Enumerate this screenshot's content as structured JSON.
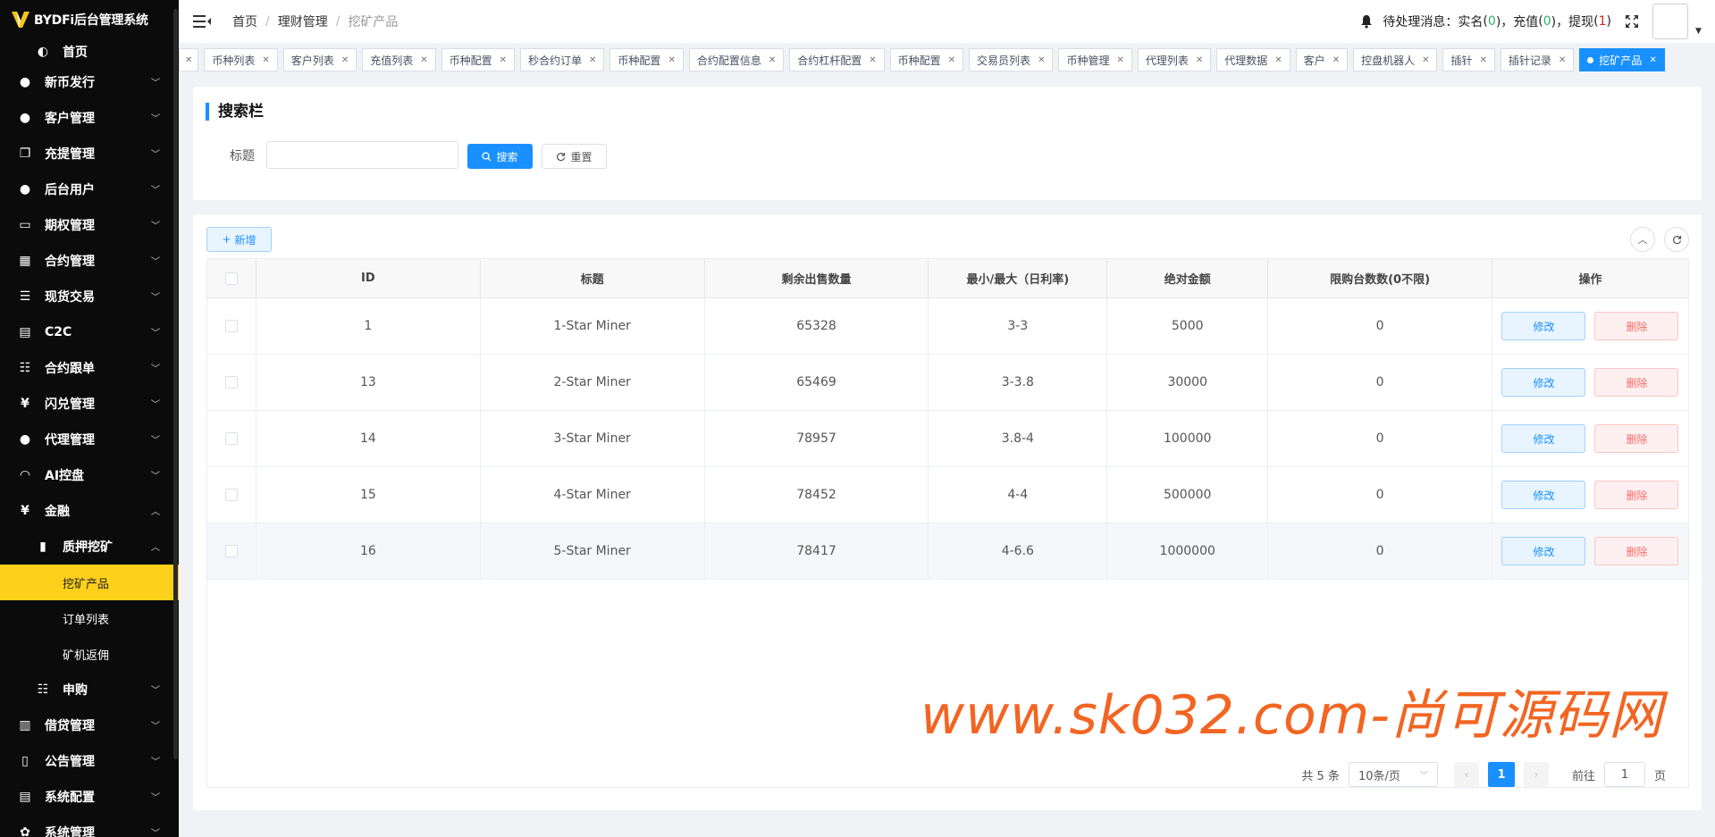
{
  "logo": {
    "brand": "BYDFi",
    "system": "后台管理系统"
  },
  "sidebar": {
    "items": [
      {
        "label": "首页",
        "icon": "dashboard-icon"
      },
      {
        "label": "新币发行",
        "icon": "user-icon"
      },
      {
        "label": "客户管理",
        "icon": "user-icon"
      },
      {
        "label": "充提管理",
        "icon": "copy-icon"
      },
      {
        "label": "后台用户",
        "icon": "users-icon"
      },
      {
        "label": "期权管理",
        "icon": "monitor-icon"
      },
      {
        "label": "合约管理",
        "icon": "grid-icon"
      },
      {
        "label": "现货交易",
        "icon": "list-icon"
      },
      {
        "label": "C2C",
        "icon": "document-icon"
      },
      {
        "label": "合约跟单",
        "icon": "tree-list-icon"
      },
      {
        "label": "闪兑管理",
        "icon": "yen-icon"
      },
      {
        "label": "代理管理",
        "icon": "user-icon"
      },
      {
        "label": "AI控盘",
        "icon": "headset-icon"
      },
      {
        "label": "金融",
        "icon": "yen-icon"
      },
      {
        "label": "质押挖矿",
        "icon": "bar-chart-icon"
      },
      {
        "label": "挖矿产品",
        "icon": ""
      },
      {
        "label": "订单列表",
        "icon": ""
      },
      {
        "label": "矿机返佣",
        "icon": ""
      },
      {
        "label": "申购",
        "icon": "tree-list-icon"
      },
      {
        "label": "借贷管理",
        "icon": "book-icon"
      },
      {
        "label": "公告管理",
        "icon": "book-open-icon"
      },
      {
        "label": "系统配置",
        "icon": "document-icon"
      },
      {
        "label": "系统管理",
        "icon": "gear-icon"
      }
    ]
  },
  "header": {
    "breadcrumb": [
      "首页",
      "理财管理",
      "挖矿产品"
    ],
    "notice_label": "待处理消息：",
    "realname_label": "实名",
    "realname_count": "0",
    "recharge_label": "充值",
    "recharge_count": "0",
    "withdraw_label": "提现",
    "withdraw_count": "1"
  },
  "tags": [
    "币种列表",
    "客户列表",
    "充值列表",
    "币种配置",
    "秒合约订单",
    "币种配置",
    "合约配置信息",
    "合约杠杆配置",
    "币种配置",
    "交易员列表",
    "币种管理",
    "代理列表",
    "代理数据",
    "客户",
    "控盘机器人",
    "插针",
    "插针记录",
    "挖矿产品"
  ],
  "search": {
    "title": "搜索栏",
    "field_label": "标题",
    "placeholder": "",
    "search_btn": "搜索",
    "reset_btn": "重置"
  },
  "table": {
    "add_btn": "新增",
    "columns": [
      "ID",
      "标题",
      "剩余出售数量",
      "最小/最大（日利率)",
      "绝对金额",
      "限购台数数(0不限)",
      "操作"
    ],
    "rows": [
      {
        "id": "1",
        "title": "1-Star Miner",
        "remaining": "65328",
        "rate": "3-3",
        "amount": "5000",
        "limit": "0"
      },
      {
        "id": "13",
        "title": "2-Star Miner",
        "remaining": "65469",
        "rate": "3-3.8",
        "amount": "30000",
        "limit": "0"
      },
      {
        "id": "14",
        "title": "3-Star Miner",
        "remaining": "78957",
        "rate": "3.8-4",
        "amount": "100000",
        "limit": "0"
      },
      {
        "id": "15",
        "title": "4-Star Miner",
        "remaining": "78452",
        "rate": "4-4",
        "amount": "500000",
        "limit": "0"
      },
      {
        "id": "16",
        "title": "5-Star Miner",
        "remaining": "78417",
        "rate": "4-6.6",
        "amount": "1000000",
        "limit": "0"
      }
    ],
    "edit_btn": "修改",
    "delete_btn": "删除"
  },
  "pagination": {
    "total": "共 5 条",
    "page_size": "10条/页",
    "current": "1",
    "goto_label": "前往",
    "goto_value": "1",
    "page_suffix": "页"
  },
  "watermark": "www.sk032.com-尚可源码网",
  "colors": {
    "primary": "#1890ff",
    "active_menu": "#fdd01b",
    "sidebar_bg": "#0b0b0c",
    "danger": "#f56c6c",
    "watermark": "#f26522"
  }
}
